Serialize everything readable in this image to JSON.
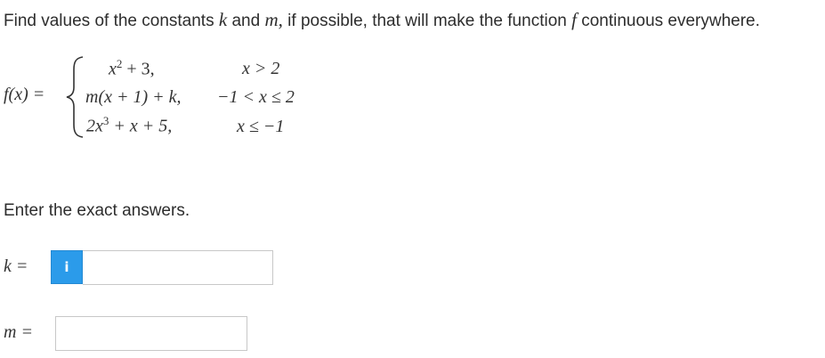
{
  "question": {
    "text_before_k": "Find values of the constants ",
    "var_k": "k",
    "text_and": " and ",
    "var_m": "m,",
    "text_middle": " if possible, that will make the function ",
    "var_f": "f",
    "text_after": " continuous everywhere."
  },
  "function": {
    "lhs": "f(x) =",
    "cases": [
      {
        "expr_base": "x",
        "expr_sup": "2",
        "expr_rest": " + 3,",
        "condition": "x > 2"
      },
      {
        "expr": "m(x + 1) + k,",
        "condition": "−1 < x ≤ 2"
      },
      {
        "expr_base": "2x",
        "expr_sup": "3",
        "expr_rest": " + x + 5,",
        "condition": "x ≤ −1"
      }
    ]
  },
  "instructions": "Enter the exact answers.",
  "answers": {
    "k_label": "k =",
    "k_value": "",
    "info_icon_glyph": "i",
    "m_label": "m =",
    "m_value": ""
  },
  "colors": {
    "info_button": "#2b9bea",
    "input_border": "#c8c8c8",
    "text": "#333333"
  }
}
